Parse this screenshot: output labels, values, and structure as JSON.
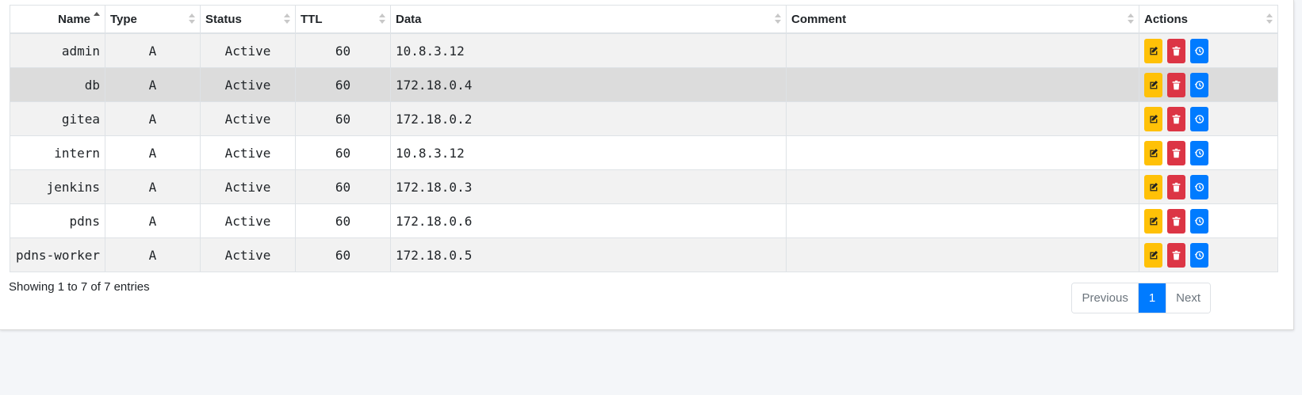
{
  "table": {
    "columns": [
      {
        "key": "name",
        "label": "Name"
      },
      {
        "key": "type",
        "label": "Type"
      },
      {
        "key": "status",
        "label": "Status"
      },
      {
        "key": "ttl",
        "label": "TTL"
      },
      {
        "key": "data",
        "label": "Data"
      },
      {
        "key": "comment",
        "label": "Comment"
      },
      {
        "key": "actions",
        "label": "Actions"
      }
    ],
    "rows": [
      {
        "name": "admin",
        "type": "A",
        "status": "Active",
        "ttl": "60",
        "data": "10.8.3.12",
        "comment": ""
      },
      {
        "name": "db",
        "type": "A",
        "status": "Active",
        "ttl": "60",
        "data": "172.18.0.4",
        "comment": ""
      },
      {
        "name": "gitea",
        "type": "A",
        "status": "Active",
        "ttl": "60",
        "data": "172.18.0.2",
        "comment": ""
      },
      {
        "name": "intern",
        "type": "A",
        "status": "Active",
        "ttl": "60",
        "data": "10.8.3.12",
        "comment": ""
      },
      {
        "name": "jenkins",
        "type": "A",
        "status": "Active",
        "ttl": "60",
        "data": "172.18.0.3",
        "comment": ""
      },
      {
        "name": "pdns",
        "type": "A",
        "status": "Active",
        "ttl": "60",
        "data": "172.18.0.6",
        "comment": ""
      },
      {
        "name": "pdns-worker",
        "type": "A",
        "status": "Active",
        "ttl": "60",
        "data": "172.18.0.5",
        "comment": ""
      }
    ],
    "sort": {
      "column": "name",
      "direction": "asc"
    }
  },
  "actions": {
    "edit_icon": "edit-icon",
    "delete_icon": "trash-icon",
    "history_icon": "history-icon",
    "edit_color": "#ffc107",
    "delete_color": "#dc3545",
    "history_color": "#007bff"
  },
  "footer": {
    "info": "Showing 1 to 7 of 7 entries",
    "pagination": {
      "previous": "Previous",
      "current_page": "1",
      "next": "Next"
    }
  },
  "colors": {
    "active_page": "#007bff",
    "row_striped": "#f2f2f2",
    "row_hover": "#dcdcdc"
  }
}
